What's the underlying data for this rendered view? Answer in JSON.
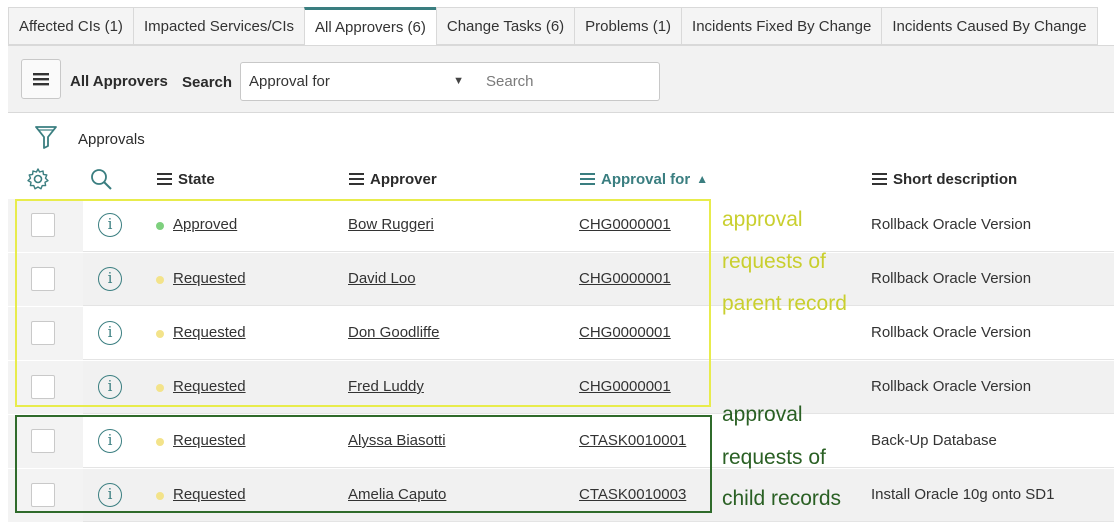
{
  "tabs": [
    {
      "label": "Affected CIs (1)",
      "active": false
    },
    {
      "label": "Impacted Services/CIs",
      "active": false
    },
    {
      "label": "All Approvers (6)",
      "active": true
    },
    {
      "label": "Change Tasks (6)",
      "active": false
    },
    {
      "label": "Problems (1)",
      "active": false
    },
    {
      "label": "Incidents Fixed By Change",
      "active": false
    },
    {
      "label": "Incidents Caused By Change",
      "active": false
    }
  ],
  "toolbar": {
    "title": "All Approvers",
    "search_label": "Search",
    "search_field": "Approval for",
    "search_placeholder": "Search",
    "menu_icon": "hamburger-icon"
  },
  "filter": {
    "label": "Approvals",
    "icon": "funnel-icon"
  },
  "columns": {
    "settings_icon": "gear-icon",
    "search_icon": "search-icon",
    "state": "State",
    "approver": "Approver",
    "approval_for": "Approval for",
    "short_description": "Short description",
    "sorted_column": "approval_for",
    "sort_direction": "ascending"
  },
  "rows": [
    {
      "state": "Approved",
      "state_color": "#7ed07e",
      "approver": "Bow Ruggeri",
      "approval_for": "CHG0000001",
      "short_description": "Rollback Oracle Version"
    },
    {
      "state": "Requested",
      "state_color": "#f3e38a",
      "approver": "David Loo",
      "approval_for": "CHG0000001",
      "short_description": "Rollback Oracle Version"
    },
    {
      "state": "Requested",
      "state_color": "#f3e38a",
      "approver": "Don Goodliffe",
      "approval_for": "CHG0000001",
      "short_description": "Rollback Oracle Version"
    },
    {
      "state": "Requested",
      "state_color": "#f3e38a",
      "approver": "Fred Luddy",
      "approval_for": "CHG0000001",
      "short_description": "Rollback Oracle Version"
    },
    {
      "state": "Requested",
      "state_color": "#f3e38a",
      "approver": "Alyssa Biasotti",
      "approval_for": "CTASK0010001",
      "short_description": "Back-Up Database"
    },
    {
      "state": "Requested",
      "state_color": "#f3e38a",
      "approver": "Amelia Caputo",
      "approval_for": "CTASK0010003",
      "short_description": "Install Oracle 10g onto SD1"
    }
  ],
  "annotations": {
    "parent": [
      "approval",
      "requests of",
      "parent record"
    ],
    "child": [
      "approval",
      "requests of",
      "child records"
    ],
    "parent_color": "#e8ec4c",
    "child_color": "#2f6b2b"
  }
}
